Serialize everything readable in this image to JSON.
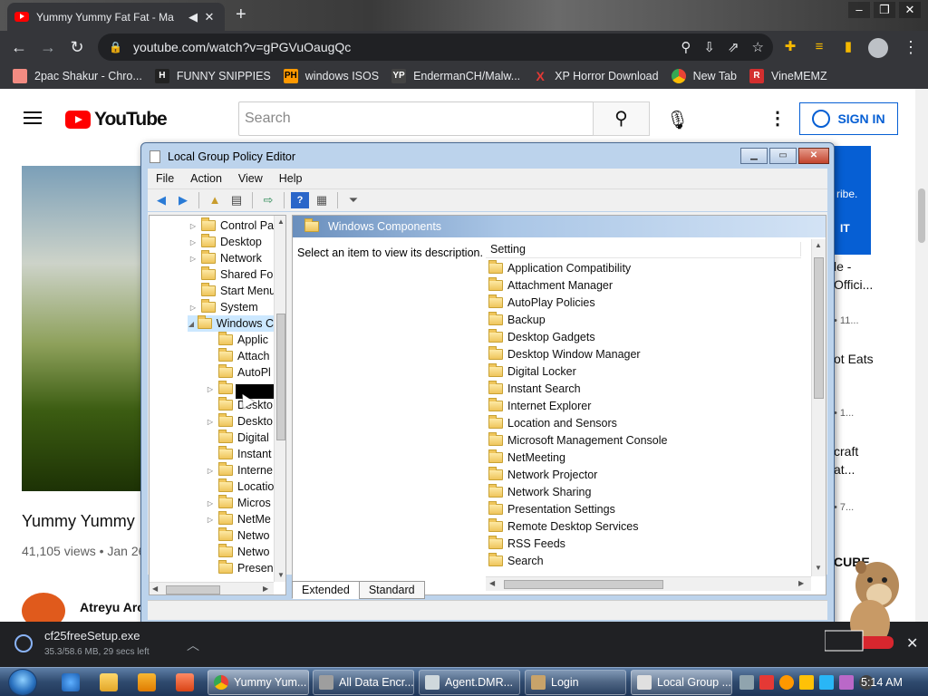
{
  "browser": {
    "tab_title": "Yummy Yummy Fat Fat - Ma",
    "url": "youtube.com/watch?v=gPGVuOaugQc",
    "bookmarks": [
      {
        "label": "2pac Shakur - Chro...",
        "icon": "puzzle-icon",
        "color": "#f28b82"
      },
      {
        "label": "FUNNY SNIPPIES",
        "icon": "H",
        "color": "#ffffff"
      },
      {
        "label": "windows ISOS",
        "icon": "PH",
        "color": "#ff9900"
      },
      {
        "label": "EndermanCH/Malw...",
        "icon": "YP",
        "color": "#444444"
      },
      {
        "label": "XP Horror Download",
        "icon": "X",
        "color": "#e53935"
      },
      {
        "label": "New Tab",
        "icon": "chrome-icon",
        "color": "#dddddd"
      },
      {
        "label": "VineMEMZ",
        "icon": "R",
        "color": "#d32f2f"
      }
    ]
  },
  "youtube": {
    "logo": "YouTube",
    "search_placeholder": "Search",
    "signin_label": "SIGN IN",
    "video_title": "Yummy Yummy",
    "video_meta": "41,105 views • Jan 26",
    "channel_name": "Atreyu Arc",
    "side_card_text": "ribe.",
    "side_card_btn": "IT",
    "side_items": [
      "le -",
      "Offici...",
      "• 11...",
      "ot Eats",
      "• 1...",
      "craft",
      "at...",
      "• 7...",
      "CUBE"
    ]
  },
  "gpedit": {
    "title": "Local Group Policy Editor",
    "menu": [
      "File",
      "Action",
      "View",
      "Help"
    ],
    "tree": [
      {
        "label": "Control Pa",
        "expand": "▷",
        "level": 0
      },
      {
        "label": "Desktop",
        "expand": "▷",
        "level": 0
      },
      {
        "label": "Network",
        "expand": "▷",
        "level": 0
      },
      {
        "label": "Shared Fol",
        "expand": "",
        "level": 0
      },
      {
        "label": "Start Menu",
        "expand": "",
        "level": 0
      },
      {
        "label": "System",
        "expand": "▷",
        "level": 0
      },
      {
        "label": "Windows C",
        "expand": "◢",
        "level": 0,
        "selected": true
      },
      {
        "label": "Applic",
        "expand": "",
        "level": 1
      },
      {
        "label": "Attach",
        "expand": "",
        "level": 1
      },
      {
        "label": "AutoPl",
        "expand": "",
        "level": 1
      },
      {
        "label": "",
        "expand": "▷",
        "level": 1
      },
      {
        "label": "Deskto",
        "expand": "",
        "level": 1
      },
      {
        "label": "Deskto",
        "expand": "▷",
        "level": 1
      },
      {
        "label": "Digital",
        "expand": "",
        "level": 1
      },
      {
        "label": "Instant",
        "expand": "",
        "level": 1
      },
      {
        "label": "Interne",
        "expand": "▷",
        "level": 1
      },
      {
        "label": "Locatio",
        "expand": "",
        "level": 1
      },
      {
        "label": "Micros",
        "expand": "▷",
        "level": 1
      },
      {
        "label": "NetMe",
        "expand": "▷",
        "level": 1
      },
      {
        "label": "Netwo",
        "expand": "",
        "level": 1
      },
      {
        "label": "Netwo",
        "expand": "",
        "level": 1
      },
      {
        "label": "Presen",
        "expand": "",
        "level": 1
      }
    ],
    "header": "Windows Components",
    "description": "Select an item to view its description.",
    "column_header": "Setting",
    "settings": [
      "Application Compatibility",
      "Attachment Manager",
      "AutoPlay Policies",
      "Backup",
      "Desktop Gadgets",
      "Desktop Window Manager",
      "Digital Locker",
      "Instant Search",
      "Internet Explorer",
      "Location and Sensors",
      "Microsoft Management Console",
      "NetMeeting",
      "Network Projector",
      "Network Sharing",
      "Presentation Settings",
      "Remote Desktop Services",
      "RSS Feeds",
      "Search"
    ],
    "tabs": [
      "Extended",
      "Standard"
    ]
  },
  "download": {
    "filename": "cf25freeSetup.exe",
    "status": "35.3/58.6 MB, 29 secs left"
  },
  "taskbar": {
    "buttons": [
      {
        "label": "Yummy Yum...",
        "icon_color": "#34a853",
        "active": true
      },
      {
        "label": "All Data Encr...",
        "icon_color": "#9e9e9e",
        "active": false
      },
      {
        "label": "Agent.DMR...",
        "icon_color": "#cfd8dc",
        "active": false
      },
      {
        "label": "Login",
        "icon_color": "#c8a36a",
        "active": false
      },
      {
        "label": "Local Group ...",
        "icon_color": "#e0e0e0",
        "active": true
      }
    ],
    "clock": "5:14 AM"
  }
}
